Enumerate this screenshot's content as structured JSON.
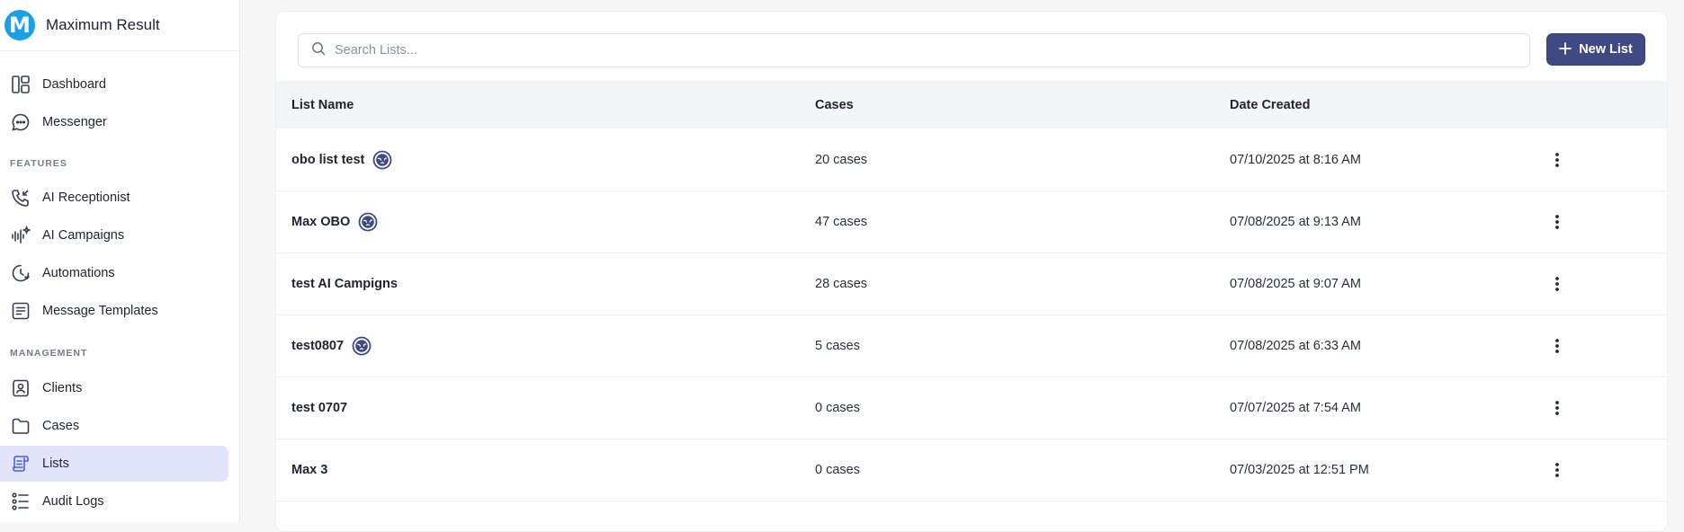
{
  "app": {
    "name": "Maximum Result",
    "logo_letter": "M",
    "accent": "#3f4a82",
    "brand_blue": "#1aa0e6"
  },
  "sidebar": {
    "items_top": [
      {
        "label": "Dashboard",
        "icon": "dashboard-icon"
      },
      {
        "label": "Messenger",
        "icon": "chat-bubble-icon"
      }
    ],
    "features_label": "FEATURES",
    "features": [
      {
        "label": "AI Receptionist",
        "icon": "phone-incoming-icon"
      },
      {
        "label": "AI Campaigns",
        "icon": "sound-wave-sparkle-icon"
      },
      {
        "label": "Automations",
        "icon": "clock-refresh-icon"
      },
      {
        "label": "Message Templates",
        "icon": "document-lines-icon"
      }
    ],
    "management_label": "MANAGEMENT",
    "management": [
      {
        "label": "Clients",
        "icon": "contact-card-icon"
      },
      {
        "label": "Cases",
        "icon": "folder-icon"
      },
      {
        "label": "Lists",
        "icon": "scroll-list-icon",
        "active": true
      },
      {
        "label": "Audit Logs",
        "icon": "list-bullets-icon"
      }
    ]
  },
  "toolbar": {
    "search_placeholder": "Search Lists...",
    "new_list_label": "New List"
  },
  "table": {
    "columns": [
      "List Name",
      "Cases",
      "Date Created"
    ],
    "rows": [
      {
        "name": "obo list test",
        "cases": "20 cases",
        "date": "07/10/2025 at 8:16 AM",
        "shared": true
      },
      {
        "name": "Max OBO",
        "cases": "47 cases",
        "date": "07/08/2025 at 9:13 AM",
        "shared": true
      },
      {
        "name": "test AI Campigns",
        "cases": "28 cases",
        "date": "07/08/2025 at 9:07 AM",
        "shared": false
      },
      {
        "name": "test0807",
        "cases": "5 cases",
        "date": "07/08/2025 at 6:33 AM",
        "shared": true
      },
      {
        "name": "test 0707",
        "cases": "0 cases",
        "date": "07/07/2025 at 7:54 AM",
        "shared": false
      },
      {
        "name": "Max 3",
        "cases": "0 cases",
        "date": "07/03/2025 at 12:51 PM",
        "shared": false
      }
    ]
  }
}
